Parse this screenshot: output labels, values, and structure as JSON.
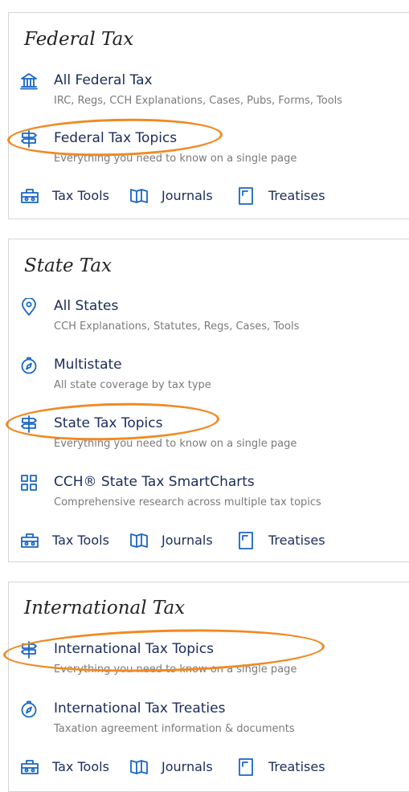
{
  "federal": {
    "title": "Federal Tax",
    "items": [
      {
        "label": "All Federal Tax",
        "desc": "IRC, Regs, CCH Explanations, Cases, Pubs, Forms, Tools"
      },
      {
        "label": "Federal Tax Topics",
        "desc": "Everything you need to know on a single page"
      }
    ]
  },
  "state": {
    "title": "State Tax",
    "items": [
      {
        "label": "All States",
        "desc": "CCH Explanations, Statutes, Regs, Cases, Tools"
      },
      {
        "label": "Multistate",
        "desc": "All state coverage by tax type"
      },
      {
        "label": "State Tax Topics",
        "desc": "Everything you need to know on a single page"
      },
      {
        "label": "CCH® State Tax SmartCharts",
        "desc": "Comprehensive research across multiple tax topics"
      }
    ]
  },
  "international": {
    "title": "International Tax",
    "items": [
      {
        "label": "International Tax Topics",
        "desc": "Everything you need to know on a single page"
      },
      {
        "label": "International Tax Treaties",
        "desc": "Taxation agreement information & documents"
      }
    ]
  },
  "links": {
    "tools": "Tax Tools",
    "journals": "Journals",
    "treatises": "Treatises"
  },
  "colors": {
    "icon": "#1a66c4",
    "label": "#1a2c5b",
    "desc": "#7a7a7a",
    "highlight": "#f08a24"
  }
}
